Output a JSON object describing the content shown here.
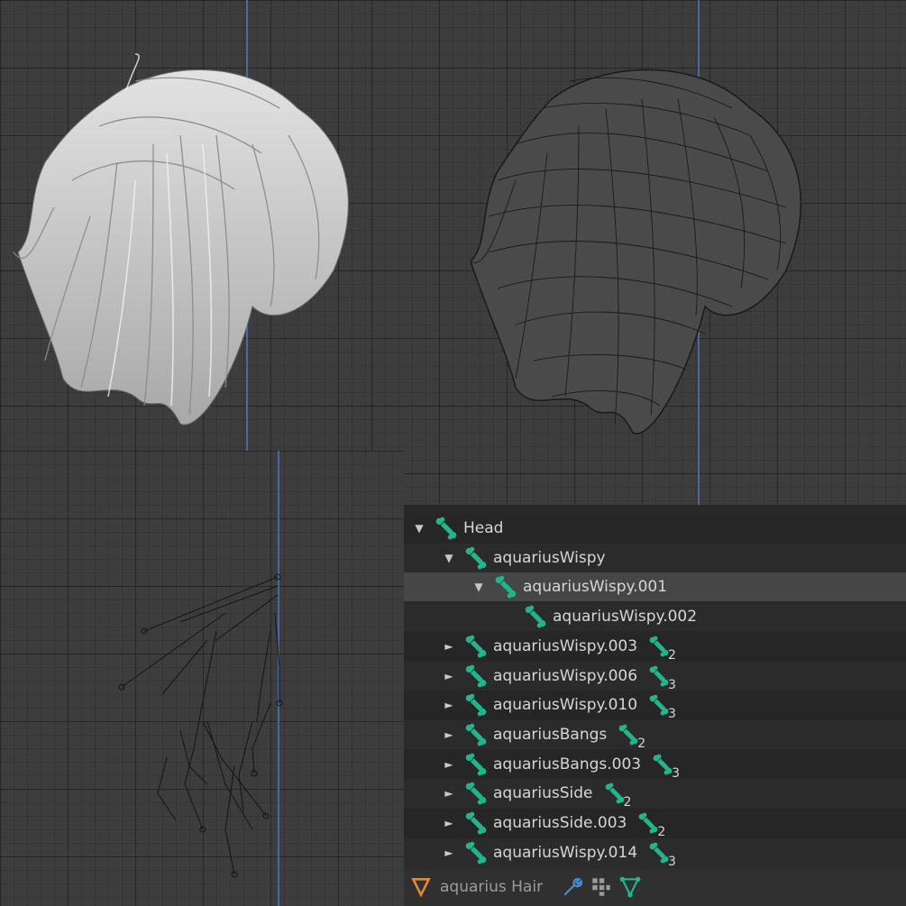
{
  "outliner": {
    "rows": [
      {
        "label": "Head",
        "expanded": true,
        "count": ""
      },
      {
        "label": "aquariusWispy",
        "expanded": true,
        "count": ""
      },
      {
        "label": "aquariusWispy.001",
        "expanded": true,
        "count": "",
        "selected": true
      },
      {
        "label": "aquariusWispy.002",
        "leaf": true,
        "count": ""
      },
      {
        "label": "aquariusWispy.003",
        "expanded": false,
        "count": "2"
      },
      {
        "label": "aquariusWispy.006",
        "expanded": false,
        "count": "3"
      },
      {
        "label": "aquariusWispy.010",
        "expanded": false,
        "count": "3"
      },
      {
        "label": "aquariusBangs",
        "expanded": false,
        "count": "2"
      },
      {
        "label": "aquariusBangs.003",
        "expanded": false,
        "count": "3"
      },
      {
        "label": "aquariusSide",
        "expanded": false,
        "count": "2"
      },
      {
        "label": "aquariusSide.003",
        "expanded": false,
        "count": "2"
      },
      {
        "label": "aquariusWispy.014",
        "expanded": false,
        "count": "3"
      }
    ],
    "bottom_label": "aquarius Hair"
  },
  "colors": {
    "bone_accent": "#22b58c",
    "axis": "#4a6fb8",
    "selected_row": "#464646"
  },
  "icons": {
    "bone": "bone-icon",
    "mesh": "mesh-data-icon",
    "modifier": "wrench-icon",
    "vertex_groups": "vertex-groups-icon",
    "shape_keys": "shape-keys-icon"
  }
}
